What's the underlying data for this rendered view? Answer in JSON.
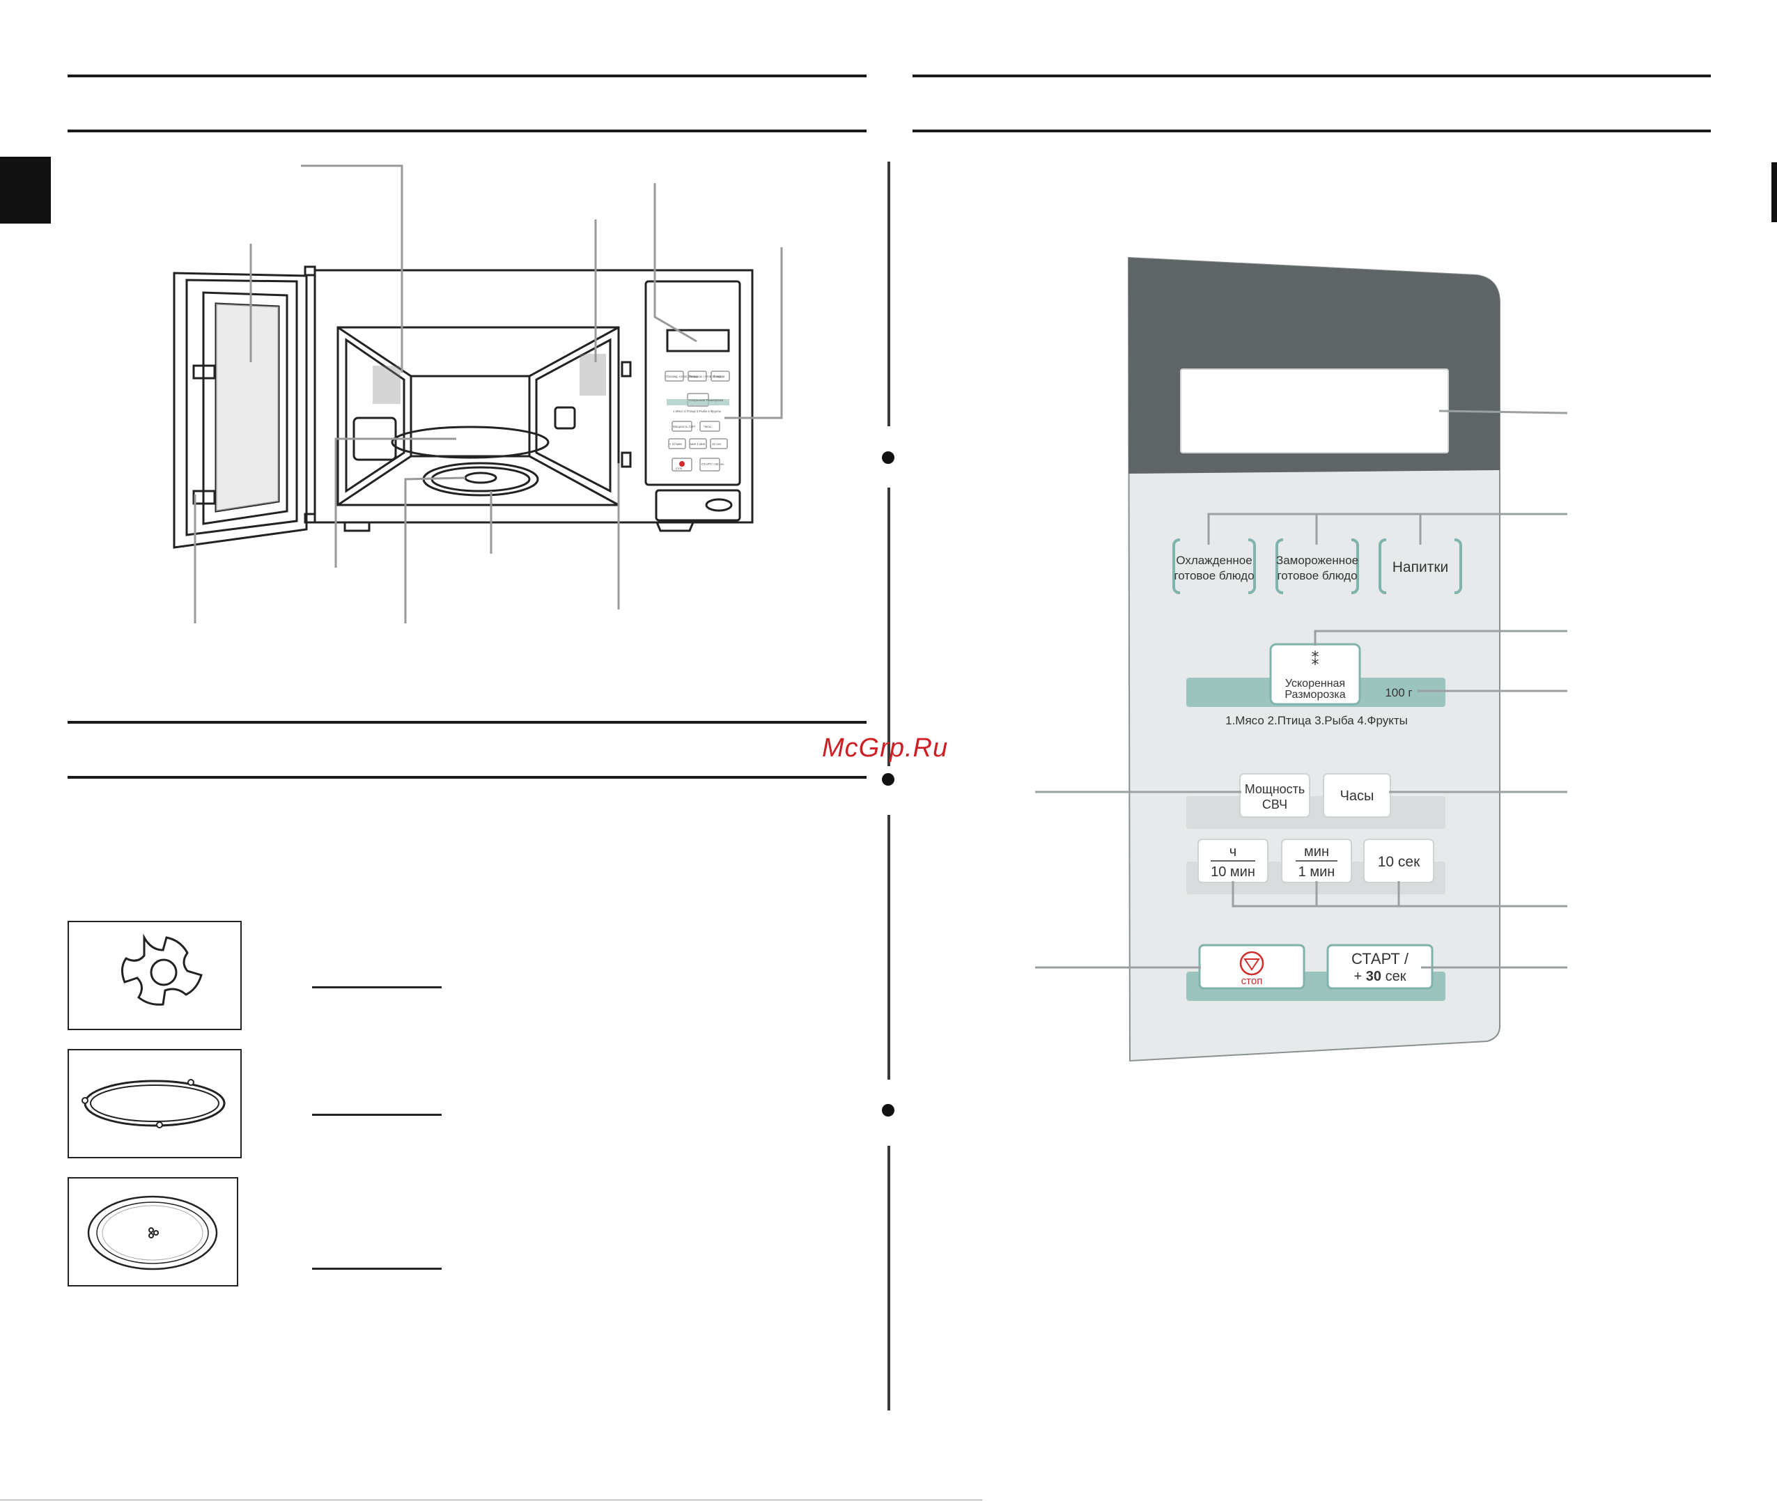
{
  "watermark": "McGrp.Ru",
  "control_panel": {
    "buttons": {
      "chilled_line1": "Охлажденное",
      "chilled_line2": "готовое блюдо",
      "frozen_line1": "Замороженное",
      "frozen_line2": "готовое блюдо",
      "drinks": "Напитки",
      "defrost_symbol": "⁑",
      "defrost_line1": "Ускоренная",
      "defrost_line2": "Разморозка",
      "weight": "100 г",
      "power_line1": "Мощность",
      "power_line2": "СВЧ",
      "clock": "Часы",
      "hours_top": "ч",
      "hours_bottom": "10 мин",
      "min_top": "мин",
      "min_bottom": "1 мин",
      "sec10": "10 сек",
      "stop": "стоп",
      "start_line1": "СТАРТ /",
      "start_line2_plus": "+",
      "start_line2_num": "30",
      "start_line2_unit": "сек"
    },
    "defrost_categories": "1.Мясо   2.Птица   3.Рыба   4.Фрукты",
    "colors": {
      "panel_top": "#5f6467",
      "panel_body": "#e7eaea",
      "teal": "#9cc4be",
      "teal_dark": "#7fb3ac",
      "stop_red": "#d32a2a"
    }
  },
  "mini_panel": {
    "b1": "Охлажд. готов. блюдо",
    "b2": "Заморож. готов. блюдо",
    "b3": "Напитки",
    "b4": "Ускоренная Разморозка",
    "cats": "1.Мясо 2.Птица 3.Рыба 4.Фрукты",
    "b5": "Мощность СВЧ",
    "b6": "Часы",
    "b7": "ч 10 мин",
    "b8": "мин 1 мин",
    "b9": "10 сек",
    "b10": "стоп",
    "b11": "СТАРТ/ +30 сек"
  }
}
